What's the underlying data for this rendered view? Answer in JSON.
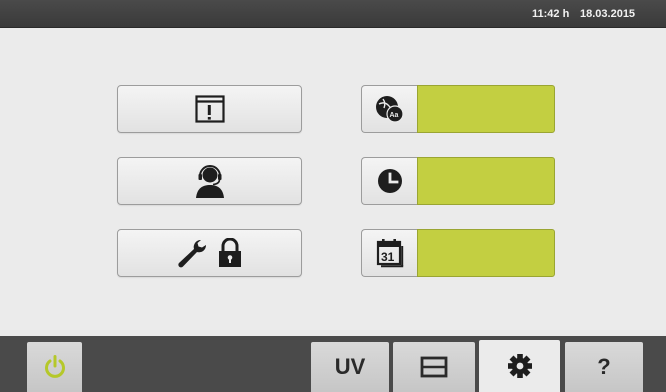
{
  "header": {
    "time": "11:42 h",
    "date": "18.03.2015"
  },
  "menu": {
    "left_buttons": [
      {
        "icon": "window-alert-icon"
      },
      {
        "icon": "service-person-headset-icon"
      },
      {
        "icon": "wrench-lock-icon"
      }
    ],
    "right_fields": [
      {
        "icon": "language-globe-icon",
        "value": ""
      },
      {
        "icon": "clock-icon",
        "value": ""
      },
      {
        "icon": "calendar-icon",
        "icon_text": "31",
        "value": ""
      }
    ],
    "field_color": "#c3cf41"
  },
  "footer": {
    "tabs": [
      {
        "id": "power",
        "icon": "power-icon"
      },
      {
        "id": "uv",
        "label": "UV"
      },
      {
        "id": "panel",
        "icon": "panel-icon"
      },
      {
        "id": "settings",
        "icon": "gear-icon",
        "active": true
      },
      {
        "id": "help",
        "label": "?"
      }
    ],
    "power_color": "#b5c82a"
  }
}
